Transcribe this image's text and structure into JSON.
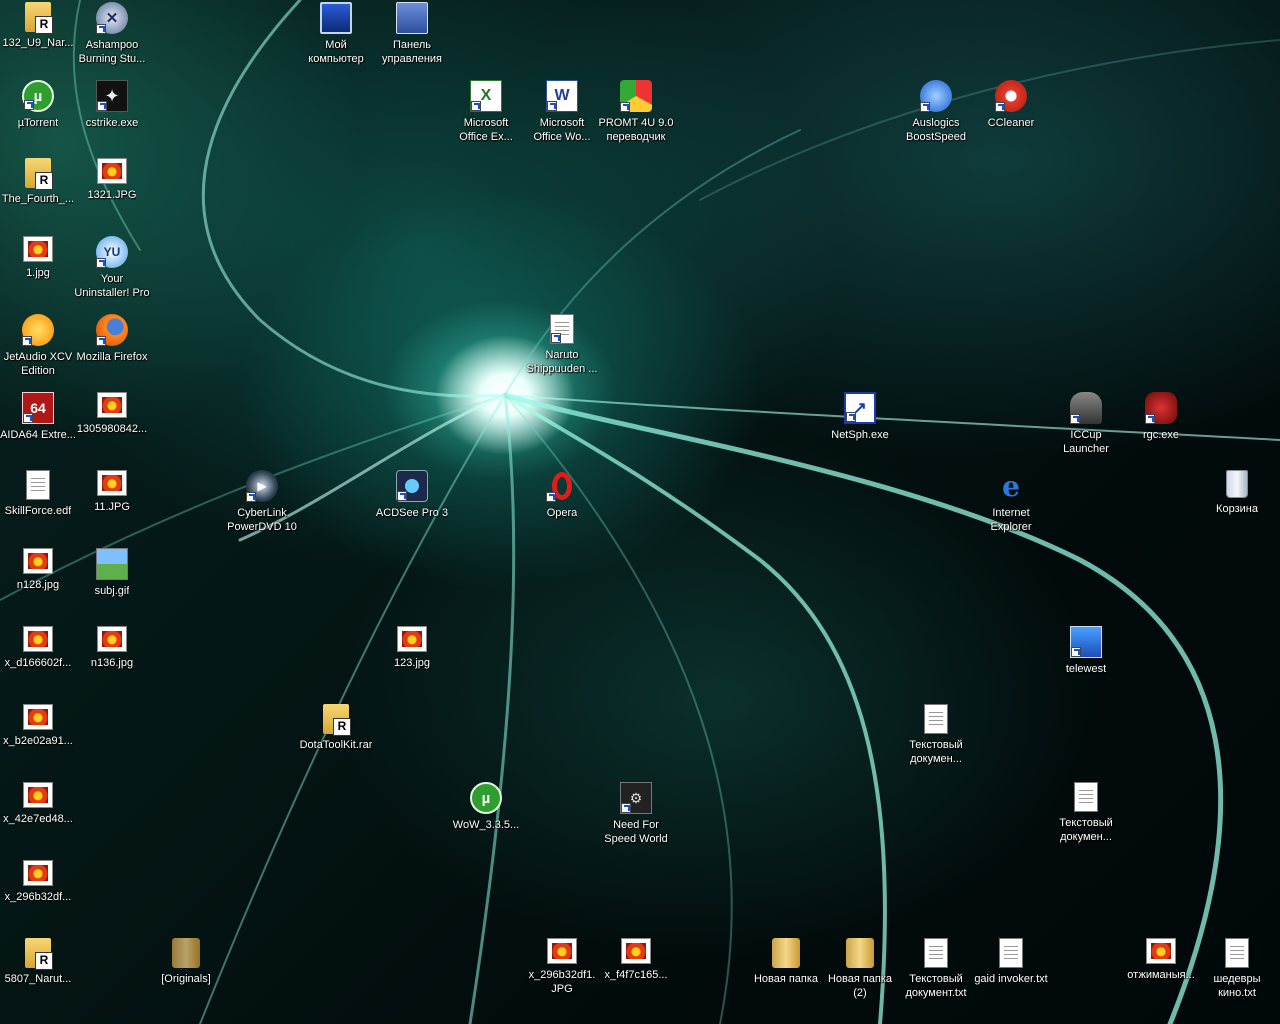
{
  "desktop": {
    "icons": {
      "rar_132": {
        "label": "132_U9_Nar..."
      },
      "ashampoo": {
        "label": "Ashampoo Burning Stu..."
      },
      "my_computer": {
        "label": "Мой компьютер"
      },
      "control_panel": {
        "label": "Панель управления"
      },
      "utorrent": {
        "label": "µTorrent"
      },
      "cstrike": {
        "label": "cstrike.exe"
      },
      "ms_excel": {
        "label": "Microsoft Office Ex..."
      },
      "ms_word": {
        "label": "Microsoft Office Wo..."
      },
      "promt": {
        "label": "PROMT 4U 9.0 переводчик"
      },
      "auslogics": {
        "label": "Auslogics BoostSpeed"
      },
      "ccleaner": {
        "label": "CCleaner"
      },
      "rar_fourth": {
        "label": "The_Fourth_..."
      },
      "img_1321": {
        "label": "1321.JPG"
      },
      "img_1": {
        "label": "1.jpg"
      },
      "your_uninstaller": {
        "label": "Your Uninstaller! Pro"
      },
      "jetaudio": {
        "label": "JetAudio XCV Edition"
      },
      "firefox": {
        "label": "Mozilla Firefox"
      },
      "naruto": {
        "label": "Naruto Shippuuden ..."
      },
      "aida64": {
        "label": "AIDA64 Extre..."
      },
      "img_1305": {
        "label": "1305980842..."
      },
      "netsph": {
        "label": "NetSph.exe"
      },
      "iccup": {
        "label": "ICCup Launcher"
      },
      "rgc": {
        "label": "rgc.exe"
      },
      "skillforce": {
        "label": "SkillForce.edf"
      },
      "img_11": {
        "label": "11.JPG"
      },
      "powerdvd": {
        "label": "CyberLink PowerDVD 10"
      },
      "acdsee": {
        "label": "ACDSee Pro 3"
      },
      "opera": {
        "label": "Opera"
      },
      "ie": {
        "label": "Internet Explorer"
      },
      "recycle": {
        "label": "Корзина"
      },
      "img_n128": {
        "label": "n128.jpg"
      },
      "subj": {
        "label": "subj.gif"
      },
      "img_xd166": {
        "label": "x_d166602f..."
      },
      "img_n136": {
        "label": "n136.jpg"
      },
      "img_123": {
        "label": "123.jpg"
      },
      "telewest": {
        "label": "telewest"
      },
      "img_xb2e0": {
        "label": "x_b2e02a91..."
      },
      "dotatoolkit": {
        "label": "DotaToolKit.rar"
      },
      "txt_doc1": {
        "label": "Текстовый докумен..."
      },
      "img_x42e7": {
        "label": "x_42e7ed48..."
      },
      "wow": {
        "label": "WoW_3.3.5..."
      },
      "nfs": {
        "label": "Need For Speed World"
      },
      "txt_doc2": {
        "label": "Текстовый докумен..."
      },
      "img_x296a": {
        "label": "x_296b32df..."
      },
      "rar_5807": {
        "label": "5807_Narut..."
      },
      "originals": {
        "label": "[Originals]"
      },
      "img_x296b": {
        "label": "x_296b32df1. JPG"
      },
      "img_xf4f7": {
        "label": "x_f4f7c165..."
      },
      "new_folder": {
        "label": "Новая папка"
      },
      "new_folder2": {
        "label": "Новая папка (2)"
      },
      "txt_doc3": {
        "label": "Текстовый документ.txt"
      },
      "gaid": {
        "label": "gaid invoker.txt"
      },
      "otzhimaniya": {
        "label": "отжиманыя..."
      },
      "shedevry": {
        "label": "шедевры кино.txt"
      }
    }
  }
}
